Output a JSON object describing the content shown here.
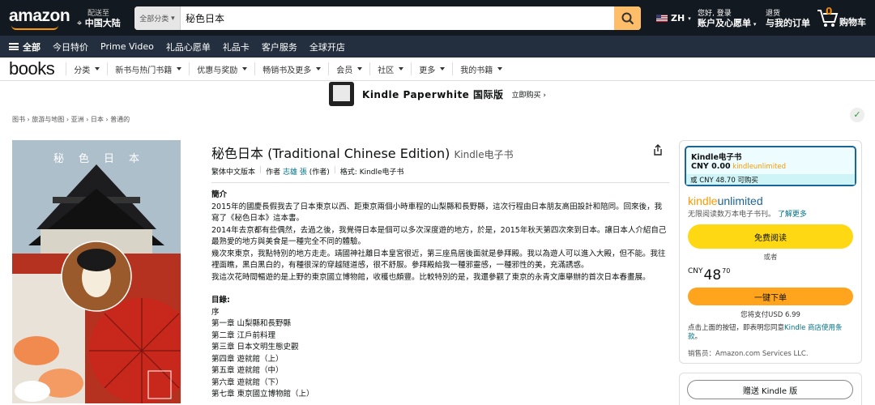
{
  "header": {
    "logo": "amazon",
    "deliver_to_small": "配送至",
    "deliver_to": "中国大陆",
    "search_category": "全部分类",
    "search_value": "秘色日本",
    "lang": "ZH",
    "account_small": "您好, 登录",
    "account": "账户及心愿单",
    "orders_small": "退货",
    "orders": "与我的订单",
    "cart_count": "0",
    "cart": "购物车"
  },
  "nav": {
    "all": "全部",
    "items": [
      "今日特价",
      "Prime Video",
      "礼品心愿单",
      "礼品卡",
      "客户服务",
      "全球开店"
    ]
  },
  "subnav": {
    "brand": "books",
    "items": [
      "分类",
      "新书与热门书籍",
      "优惠与奖励",
      "畅销书及更多",
      "会员",
      "社区",
      "更多",
      "我的书籍"
    ]
  },
  "banner": {
    "title": "Kindle Paperwhite 国际版",
    "cta": "立即购买 ›"
  },
  "breadcrumb": "图书 › 旅游与地图 › 亚洲 › 日本 › 普通的",
  "book": {
    "cover_title": "秘色日本",
    "title": "秘色日本 (Traditional Chinese Edition)",
    "format_suffix": "Kindle电子书",
    "edition": "繁体中文版本",
    "author_label": "作者",
    "author": "志雄 張",
    "author_role": "(作者)",
    "format_label": "格式:",
    "format": "Kindle电子书",
    "intro_heading": "簡介",
    "intro": [
      "2015年的國慶長假我去了日本東京以西、距東京兩個小時車程的山梨縣和長野縣，這次行程由日本朋友高田設計和陪同。回來後，我寫了《秘色日本》這本書。",
      "2014年去京都有些偶然，去過之後，我覺得日本是個可以多次深度遊的地方，於是，2015年秋天第四次來到日本。讓日本人介紹自己最熟愛的地方與美食是一種完全不同的體驗。",
      "幾次來東京，我點特別的地方走走。靖國神社離日本皇宮很近，第三座鳥居後面就是參拜殿。我以為遊人可以進入大殿，但不能。我往裡面瞧，黑白黑白的，有種很深的穿越隧道感，很不舒服。參拜殿給我一種邪靈感，一種邪性的美，充滿誘惑。",
      "我這次花時間暢遊的是上野的東京國立博物館，收穫也頗豐。比較特別的是，我還參觀了東京的永青文庫舉辦的首次日本春畫展。"
    ],
    "toc_heading": "目錄:",
    "toc": [
      "序",
      "第一章 山梨縣和長野縣",
      "第二章 江戶前料理",
      "第三章 日本文明生態史觀",
      "第四章 遊就館（上）",
      "第五章 遊就館（中）",
      "第六章 遊就館（下）",
      "第七章 東京國立博物館（上）"
    ]
  },
  "buybox": {
    "opt_label": "Kindle电子书",
    "opt_price": "CNY 0.00",
    "opt_ku": "kindleunlimited",
    "opt_alt": "或 CNY 48.70 可购买",
    "ku_logo_a": "kindle",
    "ku_logo_b": "unlimited",
    "ku_desc": "无限阅读数万本电子书刊。",
    "ku_link": "了解更多",
    "read_free": "免费阅读",
    "or": "或者",
    "currency": "CNY",
    "price_whole": "48",
    "price_frac": "70",
    "buy_now": "一键下单",
    "usd": "您将支付USD 6.99",
    "terms_a": "点击上面的按钮，即表明您同意",
    "terms_link": "Kindle 商店使用条款",
    "terms_b": "。",
    "seller": "销售员：Amazon.com Services LLC.",
    "gift": "赠送 Kindle 版"
  },
  "colors": {
    "header_bg": "#131921",
    "nav_bg": "#232f3e",
    "accent": "#febd69",
    "button_yellow": "#ffd814",
    "button_orange": "#ffa41c",
    "link": "#007185"
  }
}
